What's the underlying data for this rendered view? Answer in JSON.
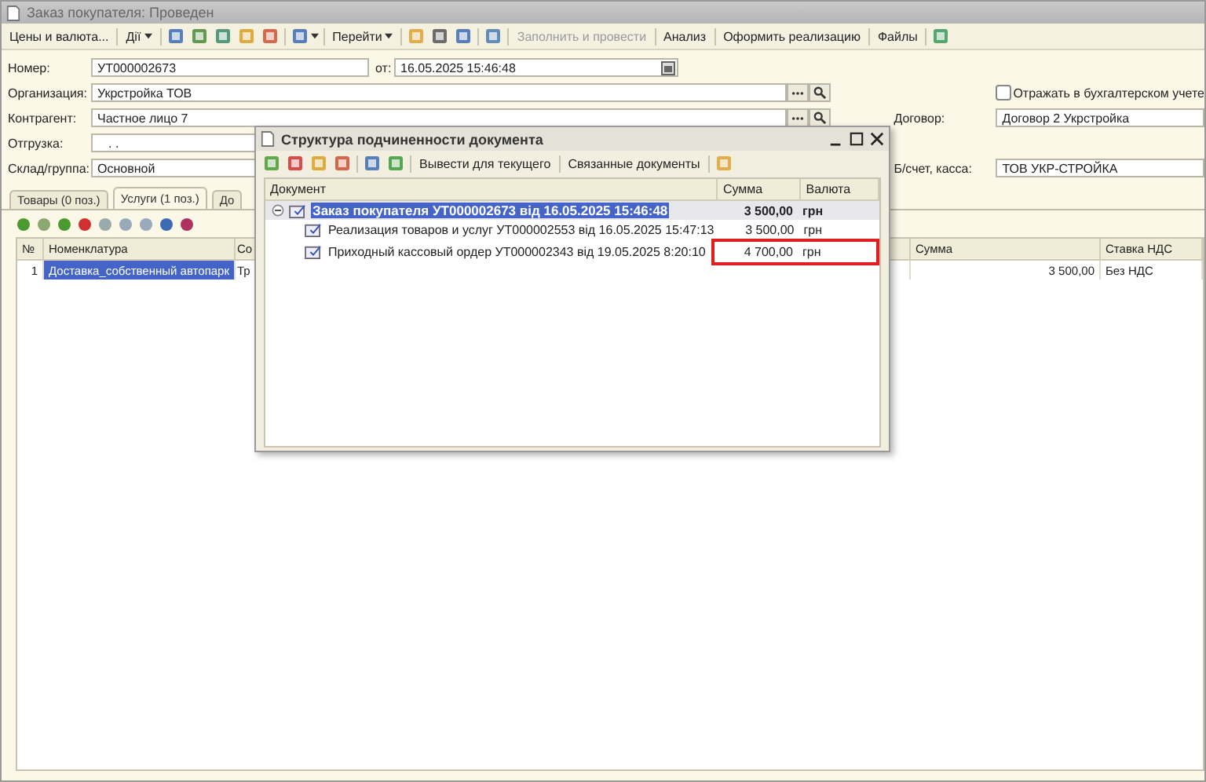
{
  "window": {
    "title": "Заказ покупателя: Проведен"
  },
  "toolbar": [
    {
      "kind": "menu",
      "label": "Цены и валюта..."
    },
    {
      "kind": "separator"
    },
    {
      "kind": "menu-caret",
      "label": "Дії"
    },
    {
      "kind": "separator"
    },
    {
      "kind": "icon"
    },
    {
      "kind": "icon"
    },
    {
      "kind": "icon"
    },
    {
      "kind": "icon"
    },
    {
      "kind": "icon"
    },
    {
      "kind": "separator"
    },
    {
      "kind": "icon-caret"
    },
    {
      "kind": "separator"
    },
    {
      "kind": "menu-caret",
      "label": "Перейти"
    },
    {
      "kind": "separator"
    },
    {
      "kind": "icon"
    },
    {
      "kind": "icon"
    },
    {
      "kind": "icon"
    },
    {
      "kind": "separator"
    },
    {
      "kind": "icon"
    },
    {
      "kind": "separator"
    },
    {
      "kind": "button",
      "label": "Заполнить и провести",
      "disabled": true
    },
    {
      "kind": "separator"
    },
    {
      "kind": "button",
      "label": "Анализ",
      "disabled": false
    },
    {
      "kind": "separator"
    },
    {
      "kind": "button",
      "label": "Оформить реализацию",
      "disabled": false
    },
    {
      "kind": "separator"
    },
    {
      "kind": "button",
      "label": "Файлы",
      "disabled": false
    },
    {
      "kind": "separator"
    },
    {
      "kind": "icon"
    }
  ],
  "form": {
    "number": {
      "label": "Номер:",
      "value": "УТ000002673"
    },
    "date": {
      "label": "от:",
      "value": "16.05.2025 15:46:48"
    },
    "organization": {
      "label": "Организация:",
      "value": "Укрстройка ТОВ"
    },
    "counterparty": {
      "label": "Контрагент:",
      "value": "Частное лицо 7"
    },
    "shipment": {
      "label": "Отгрузка:",
      "value": ". ."
    },
    "warehouse": {
      "label": "Склад/группа:",
      "value": "Основной"
    },
    "accounting": {
      "label": "Отражать в бухгалтерском учете",
      "checked": false
    },
    "contract": {
      "label": "Договор:",
      "value": "Договор 2 Укрстройка"
    },
    "account": {
      "label": "Б/счет, касса:",
      "value": "ТОВ УКР-СТРОЙКА"
    }
  },
  "tabs": [
    {
      "label": "Товары (0 поз.)",
      "selected": false
    },
    {
      "label": "Услуги (1 поз.)",
      "selected": true
    },
    {
      "label": "До",
      "selected": false
    }
  ],
  "table": {
    "columns": [
      "№",
      "Номенклатура",
      "Со",
      "Сумма",
      "Ставка НДС"
    ],
    "rows": [
      {
        "number": "1",
        "item": "Доставка_собственный автопарк",
        "column_3": "Тр",
        "sum": "3 500,00",
        "vat": "Без НДС",
        "selected": true
      }
    ]
  },
  "dialog": {
    "title": "Структура подчиненности документа",
    "toolbar": [
      {
        "kind": "icon"
      },
      {
        "kind": "icon"
      },
      {
        "kind": "icon"
      },
      {
        "kind": "icon"
      },
      {
        "kind": "separator"
      },
      {
        "kind": "icon"
      },
      {
        "kind": "icon"
      },
      {
        "kind": "separator"
      },
      {
        "kind": "button",
        "label": "Вывести для текущего"
      },
      {
        "kind": "separator"
      },
      {
        "kind": "button",
        "label": "Связанные документы"
      },
      {
        "kind": "separator"
      },
      {
        "kind": "icon"
      }
    ],
    "columns": [
      "Документ",
      "Сумма",
      "Валюта"
    ],
    "tree": [
      {
        "document": "Заказ покупателя УТ000002673 від 16.05.2025 15:46:48",
        "sum": "3 500,00",
        "currency": "грн",
        "selected": true,
        "expanded": true,
        "highlighted": false,
        "children": [
          {
            "document": "Реализация товаров и услуг УТ000002553 від 16.05.2025 15:47:13",
            "sum": "3 500,00",
            "currency": "грн",
            "selected": false,
            "highlighted": false
          },
          {
            "document": "Приходный кассовый ордер УТ000002343 від 19.05.2025 8:20:10",
            "sum": "4 700,00",
            "currency": "грн",
            "selected": false,
            "highlighted": true
          }
        ]
      }
    ]
  }
}
